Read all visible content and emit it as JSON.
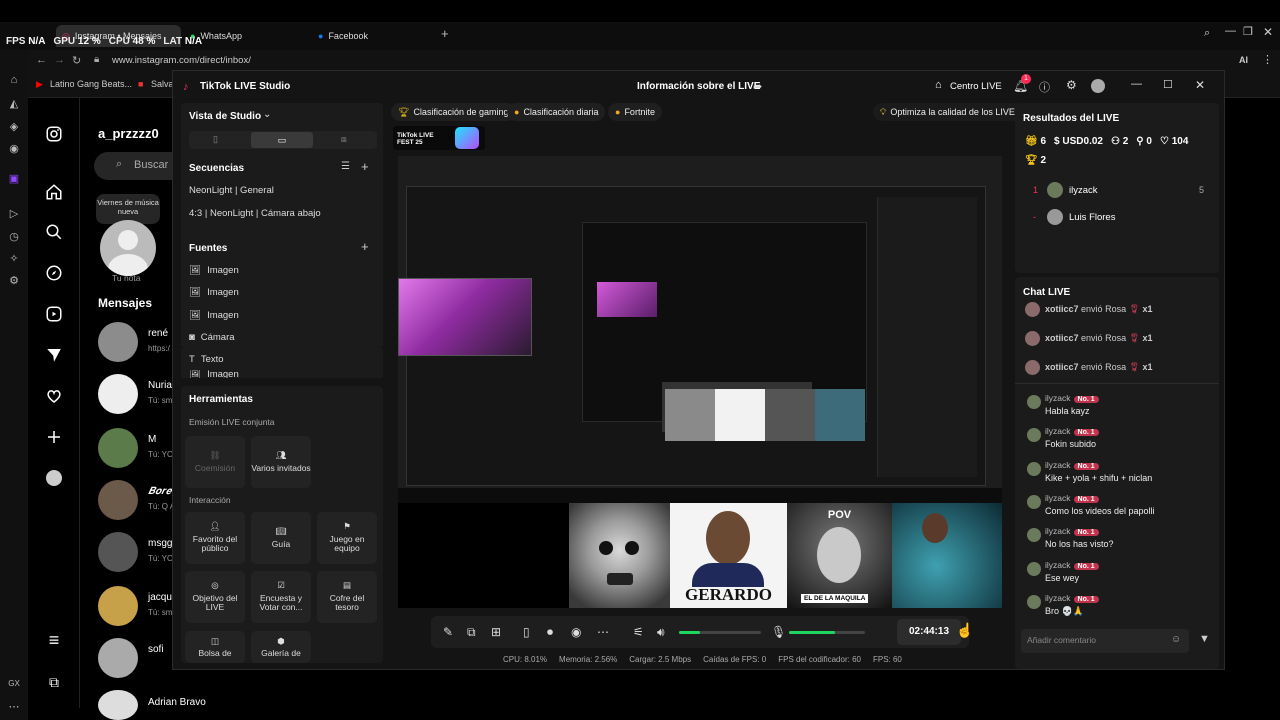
{
  "browser": {
    "tabs": [
      {
        "label": "Instagram • Mensajes"
      },
      {
        "label": "WhatsApp"
      },
      {
        "label": "Facebook"
      }
    ],
    "new_tab": "+",
    "url": "www.instagram.com/direct/inbox/",
    "bookmarks": [
      "Latino Gang Beats...",
      "Salva"
    ],
    "ai_label": "AI"
  },
  "overlay": {
    "fps_label": "FPS",
    "fps_value": "N/A",
    "gpu_label": "GPU",
    "gpu_value": "12 %",
    "cpu_label": "CPU",
    "cpu_value": "48 %",
    "lat_label": "LAT",
    "lat_value": "N/A"
  },
  "instagram": {
    "username": "a_przzzz0",
    "search_placeholder": "Buscar",
    "note_bubble": "Viernes de música nueva",
    "note_label": "Tu nota",
    "messages_title": "Mensajes",
    "conversations": [
      {
        "name": "rené",
        "preview": "https:/"
      },
      {
        "name": "Nuria",
        "preview": "Tú: sm"
      },
      {
        "name": "M",
        "preview": "Tú: YO"
      },
      {
        "name": "𝑩𝒐𝒓𝒆",
        "preview": "Tú: Q A"
      },
      {
        "name": "msgg",
        "preview": "Tú: YO"
      },
      {
        "name": "jacqu",
        "preview": "Tú: sm"
      },
      {
        "name": "sofi",
        "preview": ""
      },
      {
        "name": "Adrian Bravo",
        "preview": ""
      }
    ],
    "bottom_label": "GX"
  },
  "studio": {
    "app_title": "TikTok LIVE Studio",
    "live_info": "Información sobre el LIVE",
    "center_live": "Centro LIVE",
    "notif_count": "1",
    "view_label": "Vista de Studio",
    "sequences_title": "Secuencias",
    "sequences": [
      "NeonLight | General",
      "4:3 | NeonLight | Cámara abajo"
    ],
    "sources_title": "Fuentes",
    "sources": [
      {
        "icon": "image-icon",
        "label": "Imagen"
      },
      {
        "icon": "image-icon",
        "label": "Imagen"
      },
      {
        "icon": "image-icon",
        "label": "Imagen"
      },
      {
        "icon": "camera-icon",
        "label": "Cámara"
      },
      {
        "icon": "text-icon",
        "label": "Texto"
      },
      {
        "icon": "image-icon",
        "label": "Imagen"
      }
    ],
    "tools_title": "Herramientas",
    "collab_title": "Emisión LIVE conjunta",
    "collab_tools": [
      "Coemisión",
      "Varios invitados"
    ],
    "interaction_title": "Interacción",
    "interaction_tools": [
      "Favorito del público",
      "Guía",
      "Juego en equipo",
      "Objetivo del LIVE",
      "Encuesta y Votar con...",
      "Cofre del tesoro",
      "Bolsa de",
      "Galería de"
    ],
    "chips": [
      "Clasificación de gaming",
      "Clasificación diaria",
      "Fortnite"
    ],
    "optimize": "Optimiza la calidad de los LIVE",
    "fest_label": "TikTok LIVE FEST 25",
    "cam_labels": [
      "GERARDO",
      "POV",
      "EL DE LA MAQUILA"
    ],
    "timer": "02:44:13",
    "status": {
      "cpu": "CPU: 8.01%",
      "memory": "Memoria: 2.56%",
      "load": "Cargar: 2.5 Mbps",
      "fps_drops": "Caídas de FPS: 0",
      "encoder_fps": "FPS del codificador: 60",
      "fps": "FPS: 60"
    },
    "results_title": "Resultados del LIVE",
    "stats": {
      "gifts": "6",
      "usd": "USD0.02",
      "users": "2",
      "new": "0",
      "likes": "104",
      "rank": "2"
    },
    "top_viewers": [
      {
        "rank": "1",
        "name": "ilyzack",
        "score": "5"
      },
      {
        "rank": "-",
        "name": "Luis Flores",
        "score": ""
      }
    ],
    "chat_title": "Chat LIVE",
    "gift_events": [
      {
        "user": "xotiicc7",
        "action": "envió Rosa",
        "count": "x1"
      },
      {
        "user": "xotiicc7",
        "action": "envió Rosa",
        "count": "x1"
      },
      {
        "user": "xotiicc7",
        "action": "envió Rosa",
        "count": "x1"
      }
    ],
    "level_badge": "No. 1",
    "chat": [
      {
        "user": "ilyzack",
        "msg": "Habla kayz"
      },
      {
        "user": "ilyzack",
        "msg": "Fokin subido"
      },
      {
        "user": "ilyzack",
        "msg": "Kike + yola + shifu + niclan"
      },
      {
        "user": "ilyzack",
        "msg": "Como los videos del papolli"
      },
      {
        "user": "ilyzack",
        "msg": "No los has visto?"
      },
      {
        "user": "ilyzack",
        "msg": "Ese wey"
      },
      {
        "user": "ilyzack",
        "msg": "Bro 💀🙏"
      }
    ],
    "comment_placeholder": "Añadir comentario"
  },
  "colors": {
    "accent_green": "#1ed760",
    "tiktok_red": "#fe2c55",
    "gift_pink": "#c2344d"
  }
}
